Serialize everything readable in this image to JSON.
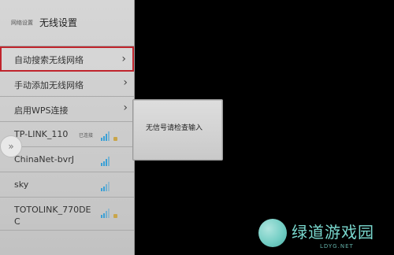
{
  "header": {
    "breadcrumb": "网络设置",
    "title": "无线设置"
  },
  "menu": {
    "items": [
      {
        "label": "自动搜索无线网络",
        "chevron": "›"
      },
      {
        "label": "手动添加无线网络",
        "chevron": "›"
      },
      {
        "label": "启用WPS连接",
        "chevron": "›"
      }
    ]
  },
  "networks": [
    {
      "ssid": "TP-LINK_110",
      "status": "已连接",
      "signal": 3,
      "locked": true
    },
    {
      "ssid": "ChinaNet-bvrJ",
      "status": "",
      "signal": 3,
      "locked": false
    },
    {
      "ssid": "sky",
      "status": "",
      "signal": 2,
      "locked": false
    },
    {
      "ssid": "TOTOLINK_770DE",
      "ssid_line2": "C",
      "status": "",
      "signal": 2,
      "locked": true
    }
  ],
  "dialog": {
    "message": "无信号请检查输入"
  },
  "left_handle": {
    "icon": "double-chevron-right-icon",
    "glyph": "»"
  },
  "watermark": {
    "title": "绿道游戏园",
    "subtitle": "LDYG.NET"
  },
  "colors": {
    "selection_border": "#c0242c",
    "wifi": "#3aa0d6",
    "watermark": "#7ad9cf"
  }
}
